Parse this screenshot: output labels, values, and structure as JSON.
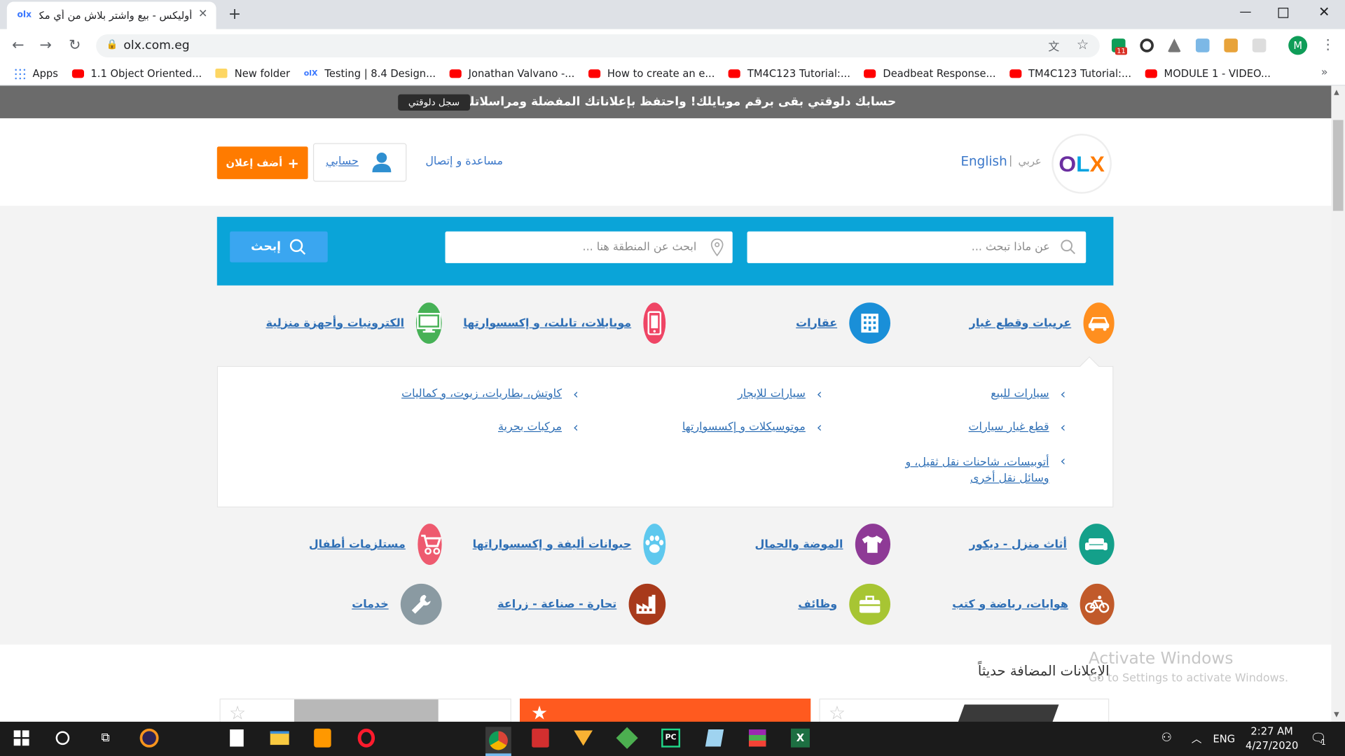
{
  "browser": {
    "tab_title": "أوليكس - بيع واشتر بلاش من أي مكان",
    "tab_favicon": "olx",
    "url": "olx.com.eg",
    "profile_initial": "M",
    "ext_badge": "11",
    "bookmarks": [
      {
        "label": "Apps",
        "icon": "apps-grid-icon"
      },
      {
        "label": "1.1 Object Oriented...",
        "icon": "youtube-icon"
      },
      {
        "label": "New folder",
        "icon": "folder-icon"
      },
      {
        "label": "Testing | 8.4 Design...",
        "icon": "olx-icon"
      },
      {
        "label": "Jonathan Valvano -...",
        "icon": "youtube-icon"
      },
      {
        "label": "How to create an e...",
        "icon": "youtube-icon"
      },
      {
        "label": "TM4C123 Tutorial:...",
        "icon": "youtube-icon"
      },
      {
        "label": "Deadbeat Response...",
        "icon": "youtube-icon"
      },
      {
        "label": "TM4C123 Tutorial:...",
        "icon": "youtube-icon"
      },
      {
        "label": "MODULE 1 - VIDEO...",
        "icon": "youtube-icon"
      }
    ],
    "bookmarks_more": "»"
  },
  "promo": {
    "text": "حسابك دلوقتي بقى برقم موبايلك! واحتفظ بإعلاناتك المفضلة ومراسلاتك كلها",
    "button": "سجل دلوقتي"
  },
  "header": {
    "logo": "OLX",
    "lang_en": "English",
    "lang_sep": "|",
    "lang_ar": "عربي",
    "help": "مساعدة و إتصال",
    "my_account": "حسابي",
    "post_ad": "أضف إعلان"
  },
  "search": {
    "what_placeholder": "عن ماذا تبحث ...",
    "where_placeholder": "ابحث عن المنطقة هنا ...",
    "button": "إبحث"
  },
  "categories_row1": [
    {
      "label": "عربيات وقطع غيار",
      "color": "#ff8f1f",
      "icon": "car-icon"
    },
    {
      "label": "عقارات",
      "color": "#1a8fd8",
      "icon": "building-icon"
    },
    {
      "label": "موبايلات، تابلت، و إكسسوارتها",
      "color": "#ef4565",
      "icon": "mobile-phone-icon"
    },
    {
      "label": "الكترونيات وأجهزة منزلية",
      "color": "#46b156",
      "icon": "monitor-icon"
    }
  ],
  "subcategories": {
    "col1": [
      "سيارات للبيع",
      "قطع غيار سيارات",
      "أتوبيسات، شاحنات نقل ثقيل، و وسائل نقل أخرى"
    ],
    "col2": [
      "سيارات للإيجار",
      "موتوسيكلات و إكسسوارتها"
    ],
    "col3": [
      "كاوتش، بطاريات، زيوت، و كماليات",
      "مركبات بحرية"
    ]
  },
  "categories_row2": [
    {
      "label": "أثاث منزل - ديكور",
      "color": "#14a08a",
      "icon": "sofa-icon"
    },
    {
      "label": "الموضة والجمال",
      "color": "#8e3a96",
      "icon": "tshirt-icon"
    },
    {
      "label": "حيوانات أليفة و إكسسواراتها",
      "color": "#5ec8ee",
      "icon": "paw-icon"
    },
    {
      "label": "مستلزمات أطفال",
      "color": "#ee5a6f",
      "icon": "stroller-icon"
    }
  ],
  "categories_row3": [
    {
      "label": "هوايات، رياضة و كتب",
      "color": "#c15a2a",
      "icon": "bicycle-icon"
    },
    {
      "label": "وظائف",
      "color": "#a7c533",
      "icon": "briefcase-icon"
    },
    {
      "label": "تجارة - صناعة - زراعة",
      "color": "#a83a1b",
      "icon": "factory-icon"
    },
    {
      "label": "خدمات",
      "color": "#8a9aa2",
      "icon": "wrench-icon"
    }
  ],
  "recent": {
    "title": "الإعلانات المضافة حديثاً"
  },
  "watermark": {
    "line1": "Activate Windows",
    "line2": "Go to Settings to activate Windows."
  },
  "taskbar": {
    "lang": "ENG",
    "time": "2:27 AM",
    "date": "4/27/2020",
    "notifications": "1"
  }
}
